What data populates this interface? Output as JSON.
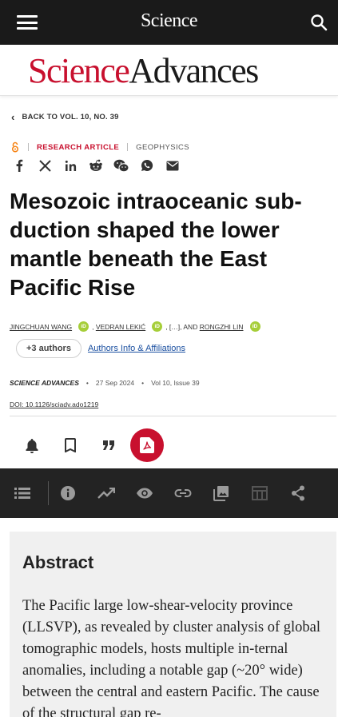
{
  "header": {
    "brand": "Science",
    "menu_icon": "hamburger-menu-icon",
    "search_icon": "search-icon"
  },
  "journal": {
    "name_part1": "Science",
    "name_part2": "Advances",
    "brand_color": "#c8102e"
  },
  "breadcrumb": {
    "back_label": "BACK TO VOL. 10, NO. 39"
  },
  "article": {
    "access_icon": "open-access-icon",
    "type": "RESEARCH ARTICLE",
    "subject": "GEOPHYSICS",
    "title": "Mesozoic intraoceanic sub-duction shaped the lower mantle beneath the East Pacific Rise",
    "authors": {
      "a1": "JINGCHUAN WANG",
      "a2": "VEDRAN LEKIĆ",
      "ellipsis": ", […], AND",
      "a3": "RONGZHI LIN",
      "sep": ",",
      "orcid_label": "iD",
      "more_button": "+3 authors",
      "affiliations_link": "Authors Info & Affiliations"
    },
    "journal_name": "SCIENCE ADVANCES",
    "date": "27 Sep 2024",
    "volume": "Vol 10, Issue 39",
    "doi": "DOI: 10.1126/sciadv.ado1219",
    "dot": "•"
  },
  "share_icons": [
    "facebook-icon",
    "x-twitter-icon",
    "linkedin-icon",
    "reddit-icon",
    "wechat-icon",
    "whatsapp-icon",
    "email-icon"
  ],
  "actions": [
    "alert-bell-icon",
    "bookmark-icon",
    "cite-quote-icon",
    "pdf-icon"
  ],
  "section_nav": [
    "contents-list-icon",
    "info-icon",
    "metrics-icon",
    "view-icon",
    "link-icon",
    "figures-icon",
    "tables-icon",
    "share-icon"
  ],
  "abstract": {
    "heading": "Abstract",
    "text": "The Pacific large low-shear-velocity province (LLSVP), as revealed by cluster analysis of global tomographic models, hosts multiple in-ternal anomalies, including a notable gap (~20° wide) between the central and eastern Pacific. The cause of the structural gap re-"
  }
}
